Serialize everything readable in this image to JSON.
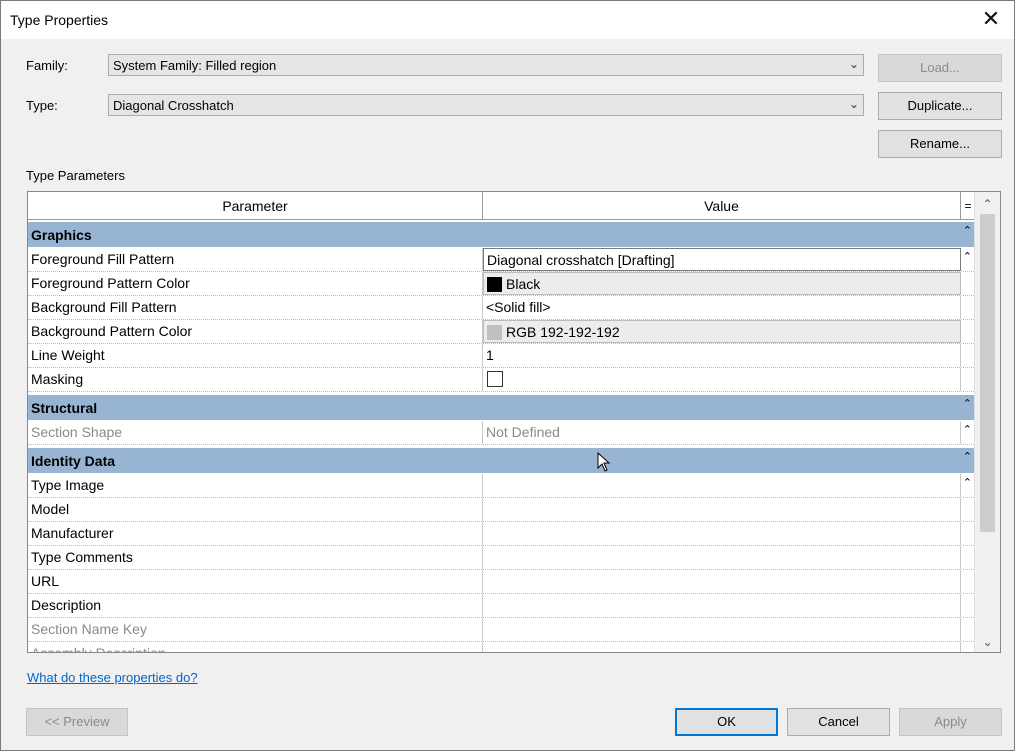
{
  "window": {
    "title": "Type Properties"
  },
  "family": {
    "label": "Family:",
    "value": "System Family: Filled region"
  },
  "type": {
    "label": "Type:",
    "value": "Diagonal Crosshatch"
  },
  "buttons": {
    "load": "Load...",
    "duplicate": "Duplicate...",
    "rename": "Rename...",
    "preview": "<< Preview",
    "ok": "OK",
    "cancel": "Cancel",
    "apply": "Apply"
  },
  "params": {
    "title": "Type Parameters",
    "col_parameter": "Parameter",
    "col_value": "Value",
    "col_eq": "=",
    "sections": [
      {
        "name": "Graphics",
        "rows": [
          {
            "param": "Foreground Fill Pattern",
            "value": "Diagonal crosshatch [Drafting]"
          },
          {
            "param": "Foreground Pattern Color",
            "value": "Black",
            "swatch": "#000000"
          },
          {
            "param": "Background Fill Pattern",
            "value": "<Solid fill>"
          },
          {
            "param": "Background Pattern Color",
            "value": "RGB 192-192-192",
            "swatch": "#c0c0c0"
          },
          {
            "param": "Line Weight",
            "value": "1"
          },
          {
            "param": "Masking",
            "value": "",
            "checked": false
          }
        ]
      },
      {
        "name": "Structural",
        "rows": [
          {
            "param": "Section Shape",
            "value": "Not Defined"
          }
        ]
      },
      {
        "name": "Identity Data",
        "rows": [
          {
            "param": "Type Image",
            "value": ""
          },
          {
            "param": "Model",
            "value": ""
          },
          {
            "param": "Manufacturer",
            "value": ""
          },
          {
            "param": "Type Comments",
            "value": ""
          },
          {
            "param": "URL",
            "value": ""
          },
          {
            "param": "Description",
            "value": ""
          },
          {
            "param": "Section Name Key",
            "value": ""
          },
          {
            "param": "Assembly Description",
            "value": ""
          }
        ]
      }
    ]
  },
  "help_link": "What do these properties do?",
  "colors": {
    "section_header": "#98b4d3",
    "link": "#0066cc",
    "accent": "#0078d7"
  }
}
